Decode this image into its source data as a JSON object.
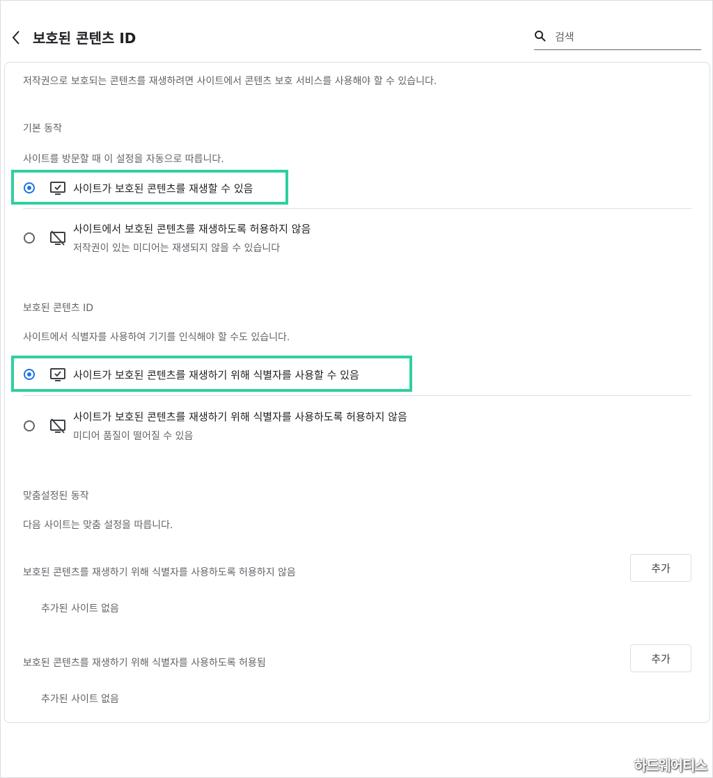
{
  "header": {
    "title": "보호된 콘텐츠 ID",
    "search_placeholder": "검색"
  },
  "intro": "저작권으로 보호되는 콘텐츠를 재생하려면 사이트에서 콘텐츠 보호 서비스를 사용해야 할 수 있습니다.",
  "default_behavior": {
    "title": "기본 동작",
    "description": "사이트를 방문할 때 이 설정을 자동으로 따릅니다.",
    "options": [
      {
        "label": "사이트가 보호된 콘텐츠를 재생할 수 있음",
        "sub": "",
        "selected": true
      },
      {
        "label": "사이트에서 보호된 콘텐츠를 재생하도록 허용하지 않음",
        "sub": "저작권이 있는 미디어는 재생되지 않을 수 있습니다",
        "selected": false
      }
    ]
  },
  "protected_id": {
    "title": "보호된 콘텐츠 ID",
    "description": "사이트에서 식별자를 사용하여 기기를 인식해야 할 수도 있습니다.",
    "options": [
      {
        "label": "사이트가 보호된 콘텐츠를 재생하기 위해 식별자를 사용할 수 있음",
        "sub": "",
        "selected": true
      },
      {
        "label": "사이트가 보호된 콘텐츠를 재생하기 위해 식별자를 사용하도록 허용하지 않음",
        "sub": "미디어 품질이 떨어질 수 있음",
        "selected": false
      }
    ]
  },
  "custom_behavior": {
    "title": "맞춤설정된 동작",
    "description": "다음 사이트는 맞춤 설정을 따릅니다.",
    "lists": [
      {
        "label": "보호된 콘텐츠를 재생하기 위해 식별자를 사용하도록 허용하지 않음",
        "button": "추가",
        "empty": "추가된 사이트 없음"
      },
      {
        "label": "보호된 콘텐츠를 재생하기 위해 식별자를 사용하도록 허용됨",
        "button": "추가",
        "empty": "추가된 사이트 없음"
      }
    ]
  },
  "watermark": "하드웨어티스",
  "colors": {
    "accent": "#1a73e8",
    "highlight": "#2ecfa0"
  }
}
